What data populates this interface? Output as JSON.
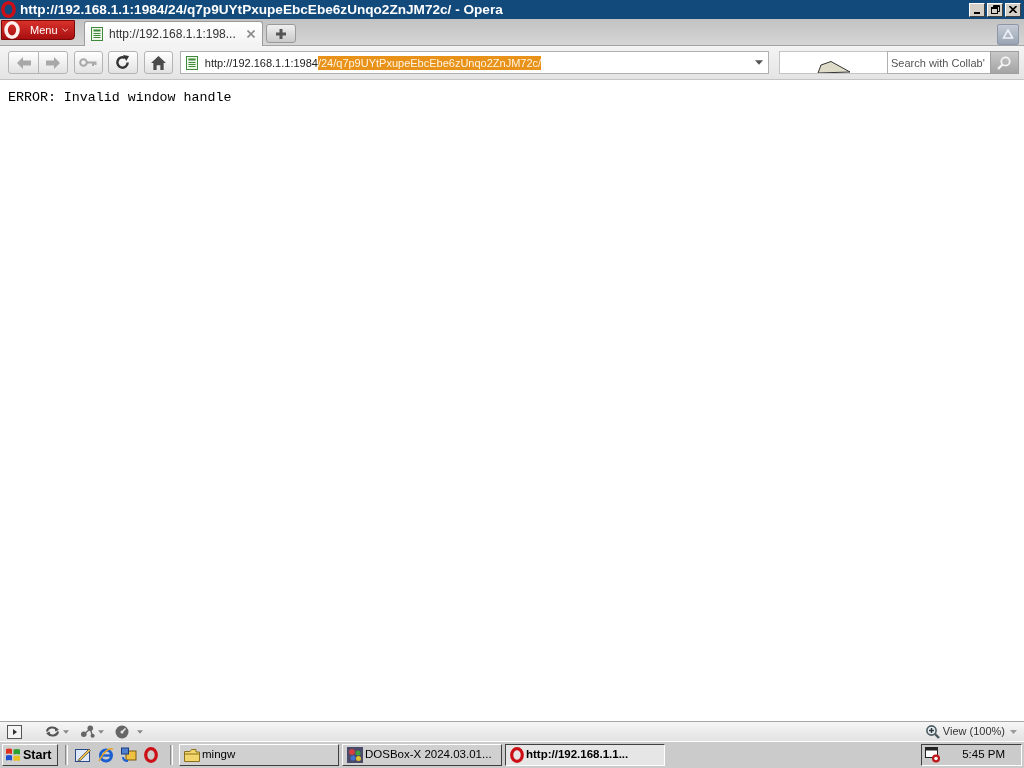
{
  "window": {
    "title": "http://192.168.1.1:1984/24/q7p9UYtPxupeEbcEbe6zUnqo2ZnJM72c/ - Opera"
  },
  "tab_bar": {
    "menu_button": "Menu",
    "tabs": [
      {
        "label": "http://192.168.1.1:198...",
        "selected": true
      }
    ]
  },
  "address_bar": {
    "parts": [
      {
        "text": "http://192.168.1.1:1984",
        "selected": false
      },
      {
        "text": "/24/q7p9UYtPxupeEbcEbe6zUnqo2ZnJM72c/",
        "selected": true
      }
    ]
  },
  "search_field": {
    "placeholder": "Search with Collab'"
  },
  "page": {
    "text": "ERROR: Invalid window handle"
  },
  "status_bar": {
    "zoom": "View (100%)"
  },
  "taskbar": {
    "start": "Start",
    "tasks": [
      {
        "label": "mingw",
        "kind": "folder",
        "selected": false
      },
      {
        "label": "DOSBox-X 2024.03.01...",
        "kind": "dosbox",
        "selected": false
      },
      {
        "label": "http://192.168.1.1...",
        "kind": "opera",
        "selected": true
      }
    ],
    "clock": "5:45 PM"
  }
}
